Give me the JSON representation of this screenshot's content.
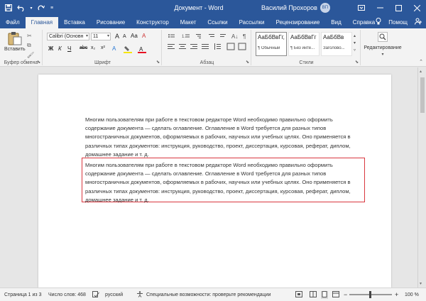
{
  "titlebar": {
    "title": "Документ - Word",
    "user_name": "Василий Прохоров",
    "user_initials": "ВП"
  },
  "tabs": [
    "Файл",
    "Главная",
    "Вставка",
    "Рисование",
    "Конструктор",
    "Макет",
    "Ссылки",
    "Рассылки",
    "Рецензирование",
    "Вид",
    "Справка"
  ],
  "tabs_right": {
    "help_label": "Помощ"
  },
  "ribbon": {
    "clipboard": {
      "paste_label": "Вставить",
      "group_label": "Буфер обмена"
    },
    "font": {
      "font_name": "Calibri (Основн",
      "font_size": "11",
      "group_label": "Шрифт",
      "bold": "Ж",
      "italic": "К",
      "underline": "Ч",
      "strike": "abc",
      "sub": "x₂",
      "sup": "x²",
      "grow": "A",
      "shrink": "A",
      "case": "Aa",
      "clear": "A",
      "text_effects": "A"
    },
    "paragraph": {
      "group_label": "Абзац"
    },
    "styles": {
      "group_label": "Стили",
      "items": [
        {
          "sample": "АаБбВвГг,",
          "name": "¶ Обычный"
        },
        {
          "sample": "АаБбВвГг",
          "name": "¶ Без инте..."
        },
        {
          "sample": "АаБбВв",
          "name": "Заголово..."
        }
      ]
    },
    "editing": {
      "label": "Редактирование"
    }
  },
  "document": {
    "para1": "Многим пользователям при работе в текстовом редакторе Word необходимо правильно оформить содержание документа — сделать оглавление. Оглавление в Word требуется для разных типов многостраничных документов, оформляемых в рабочих, научных или учебных целях. Оно применяется в различных типах документов: инструкция, руководство, проект, диссертация, курсовая, реферат, диплом, домашнее задание и т. д.",
    "para2": "Многим пользователям при работе в текстовом редакторе Word необходимо правильно оформить содержание документа — сделать оглавление. Оглавление в Word требуется для разных типов многостраничных документов, оформляемых в рабочих, научных или учебных целях. Оно применяется в различных типах документов: инструкция, руководство, проект, диссертация, курсовая, реферат, диплом, домашнее задание и т. д."
  },
  "statusbar": {
    "page": "Страница 1 из 3",
    "words": "Число слов: 468",
    "language": "русский",
    "accessibility": "Специальные возможности: проверьте рекомендации",
    "zoom": "100 %",
    "zoom_minus": "−",
    "zoom_plus": "+"
  },
  "colors": {
    "accent": "#2b579a",
    "highlight_box": "#d9373f"
  }
}
